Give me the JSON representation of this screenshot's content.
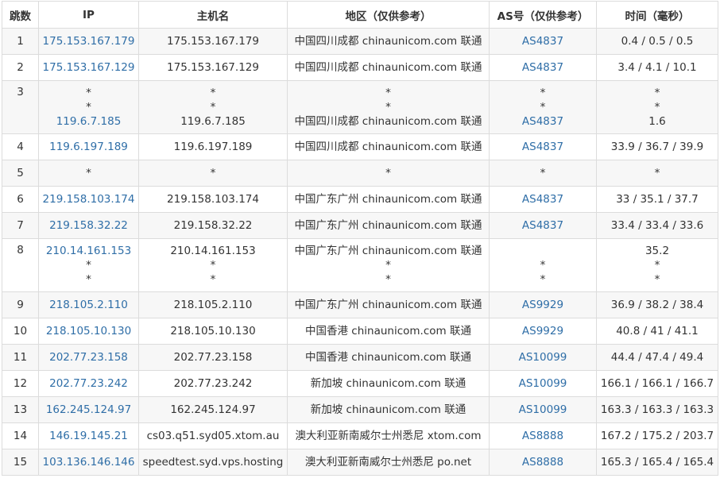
{
  "headers": [
    "跳数",
    "IP",
    "主机名",
    "地区（仅供参考）",
    "AS号（仅供参考）",
    "时间（毫秒）"
  ],
  "rows": [
    {
      "hop": "1",
      "ip": [
        "175.153.167.179"
      ],
      "host": [
        "175.153.167.179"
      ],
      "region": [
        "中国四川成都 chinaunicom.com 联通"
      ],
      "as": [
        "AS4837"
      ],
      "time": [
        "0.4 / 0.5 / 0.5"
      ]
    },
    {
      "hop": "2",
      "ip": [
        "175.153.167.129"
      ],
      "host": [
        "175.153.167.129"
      ],
      "region": [
        "中国四川成都 chinaunicom.com 联通"
      ],
      "as": [
        "AS4837"
      ],
      "time": [
        "3.4 / 4.1 / 10.1"
      ]
    },
    {
      "hop": "3",
      "ip": [
        "*",
        "*",
        "119.6.7.185"
      ],
      "host": [
        "*",
        "*",
        "119.6.7.185"
      ],
      "region": [
        "*",
        "*",
        "中国四川成都 chinaunicom.com 联通"
      ],
      "as": [
        "*",
        "*",
        "AS4837"
      ],
      "time": [
        "*",
        "*",
        "1.6"
      ]
    },
    {
      "hop": "4",
      "ip": [
        "119.6.197.189"
      ],
      "host": [
        "119.6.197.189"
      ],
      "region": [
        "中国四川成都 chinaunicom.com 联通"
      ],
      "as": [
        "AS4837"
      ],
      "time": [
        "33.9 / 36.7 / 39.9"
      ]
    },
    {
      "hop": "5",
      "ip": [
        "*"
      ],
      "host": [
        "*"
      ],
      "region": [
        "*"
      ],
      "as": [
        "*"
      ],
      "time": [
        "*"
      ]
    },
    {
      "hop": "6",
      "ip": [
        "219.158.103.174"
      ],
      "host": [
        "219.158.103.174"
      ],
      "region": [
        "中国广东广州 chinaunicom.com 联通"
      ],
      "as": [
        "AS4837"
      ],
      "time": [
        "33 / 35.1 / 37.7"
      ]
    },
    {
      "hop": "7",
      "ip": [
        "219.158.32.22"
      ],
      "host": [
        "219.158.32.22"
      ],
      "region": [
        "中国广东广州 chinaunicom.com 联通"
      ],
      "as": [
        "AS4837"
      ],
      "time": [
        "33.4 / 33.4 / 33.6"
      ]
    },
    {
      "hop": "8",
      "ip": [
        "210.14.161.153",
        "*",
        "*"
      ],
      "host": [
        "210.14.161.153",
        "*",
        "*"
      ],
      "region": [
        "中国广东广州 chinaunicom.com 联通",
        "*",
        "*"
      ],
      "as": [
        "",
        "*",
        "*"
      ],
      "time": [
        "35.2",
        "*",
        "*"
      ]
    },
    {
      "hop": "9",
      "ip": [
        "218.105.2.110"
      ],
      "host": [
        "218.105.2.110"
      ],
      "region": [
        "中国广东广州 chinaunicom.com 联通"
      ],
      "as": [
        "AS9929"
      ],
      "time": [
        "36.9 / 38.2 / 38.4"
      ]
    },
    {
      "hop": "10",
      "ip": [
        "218.105.10.130"
      ],
      "host": [
        "218.105.10.130"
      ],
      "region": [
        "中国香港 chinaunicom.com 联通"
      ],
      "as": [
        "AS9929"
      ],
      "time": [
        "40.8 / 41 / 41.1"
      ]
    },
    {
      "hop": "11",
      "ip": [
        "202.77.23.158"
      ],
      "host": [
        "202.77.23.158"
      ],
      "region": [
        "中国香港 chinaunicom.com 联通"
      ],
      "as": [
        "AS10099"
      ],
      "time": [
        "44.4 / 47.4 / 49.4"
      ]
    },
    {
      "hop": "12",
      "ip": [
        "202.77.23.242"
      ],
      "host": [
        "202.77.23.242"
      ],
      "region": [
        "新加坡 chinaunicom.com 联通"
      ],
      "as": [
        "AS10099"
      ],
      "time": [
        "166.1 / 166.1 / 166.7"
      ]
    },
    {
      "hop": "13",
      "ip": [
        "162.245.124.97"
      ],
      "host": [
        "162.245.124.97"
      ],
      "region": [
        "新加坡 chinaunicom.com 联通"
      ],
      "as": [
        "AS10099"
      ],
      "time": [
        "163.3 / 163.3 / 163.3"
      ]
    },
    {
      "hop": "14",
      "ip": [
        "146.19.145.21"
      ],
      "host": [
        "cs03.q51.syd05.xtom.au"
      ],
      "region": [
        "澳大利亚新南威尔士州悉尼 xtom.com"
      ],
      "as": [
        "AS8888"
      ],
      "time": [
        "167.2 / 175.2 / 203.7"
      ]
    },
    {
      "hop": "15",
      "ip": [
        "103.136.146.146"
      ],
      "host": [
        "speedtest.syd.vps.hosting"
      ],
      "region": [
        "澳大利亚新南威尔士州悉尼 po.net"
      ],
      "as": [
        "AS8888"
      ],
      "time": [
        "165.3 / 165.4 / 165.4"
      ]
    }
  ]
}
